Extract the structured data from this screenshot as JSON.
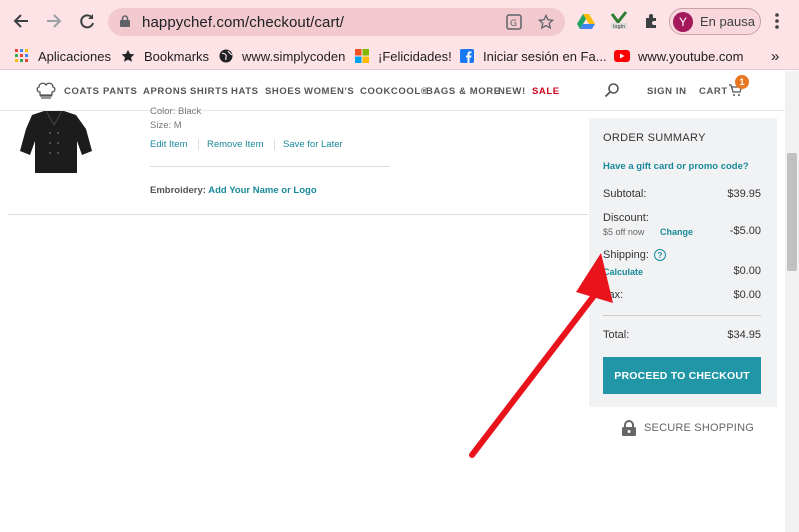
{
  "browser": {
    "url": "happychef.com/checkout/cart/",
    "profile_initial": "Y",
    "profile_label": "En pausa",
    "bookmarks": [
      {
        "label": "Aplicaciones",
        "icon": "apps-grid-icon"
      },
      {
        "label": "Bookmarks",
        "icon": "star-icon"
      },
      {
        "label": "www.simplycoden",
        "icon": "globe-icon"
      },
      {
        "label": "¡Felicidades!",
        "icon": "microsoft-icon"
      },
      {
        "label": "Iniciar sesión en Fa...",
        "icon": "facebook-icon"
      },
      {
        "label": "www.youtube.com",
        "icon": "youtube-icon"
      }
    ],
    "more_bookmarks": "»"
  },
  "site": {
    "nav": [
      "COATS",
      "PANTS",
      "APRONS",
      "SHIRTS",
      "HATS",
      "SHOES",
      "WOMEN'S",
      "COOKCOOL®",
      "BAGS & MORE",
      "NEW!",
      "SALE"
    ],
    "sign_in": "SIGN IN",
    "cart": "CART",
    "cart_count": "1"
  },
  "cart_item": {
    "color": "Color: Black",
    "size": "Size: M",
    "edit": "Edit Item",
    "remove": "Remove Item",
    "save": "Save for Later",
    "embroidery_label": "Embroidery:",
    "embroidery_link": "Add Your Name or Logo"
  },
  "summary": {
    "title": "ORDER SUMMARY",
    "promo": "Have a gift card or promo code?",
    "subtotal_label": "Subtotal:",
    "subtotal_value": "$39.95",
    "discount_label": "Discount:",
    "discount_note": "$5 off now",
    "discount_change": "Change",
    "discount_value": "-$5.00",
    "shipping_label": "Shipping:",
    "shipping_link": "Calculate",
    "shipping_value": "$0.00",
    "tax_label": "Tax:",
    "tax_value": "$0.00",
    "total_label": "Total:",
    "total_value": "$34.95",
    "checkout": "PROCEED TO CHECKOUT"
  },
  "secure": "SECURE SHOPPING",
  "colors": {
    "accent": "#2196a6",
    "sale": "#d0021b",
    "arrow": "#e8131b"
  }
}
